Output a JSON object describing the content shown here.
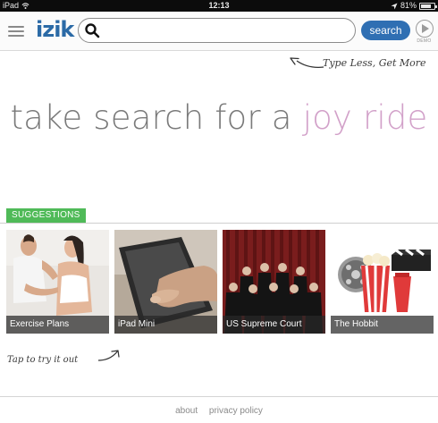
{
  "status_bar": {
    "device": "iPad",
    "time": "12:13",
    "battery": "81%",
    "battery_level": 0.81
  },
  "header": {
    "logo": "izik",
    "search_value": "",
    "search_button": "search",
    "demo_label": "DEMO"
  },
  "tagline": "Type Less, Get More",
  "hero": {
    "text_main": "take search for a ",
    "text_accent": "joy ride"
  },
  "suggestions": {
    "heading": "SUGGESTIONS",
    "items": [
      {
        "label": "Exercise Plans"
      },
      {
        "label": "iPad Mini"
      },
      {
        "label": "US Supreme Court"
      },
      {
        "label": "The Hobbit"
      }
    ]
  },
  "tap_hint": "Tap to try it out",
  "footer": {
    "about": "about",
    "privacy": "privacy policy"
  },
  "colors": {
    "accent_blue": "#2f6fb3",
    "suggest_green": "#4fba58",
    "hero_accent": "#d2a1c9"
  },
  "icons": [
    "wifi-icon",
    "location-icon",
    "battery-icon",
    "menu-icon",
    "search-icon",
    "demo-play-icon"
  ]
}
